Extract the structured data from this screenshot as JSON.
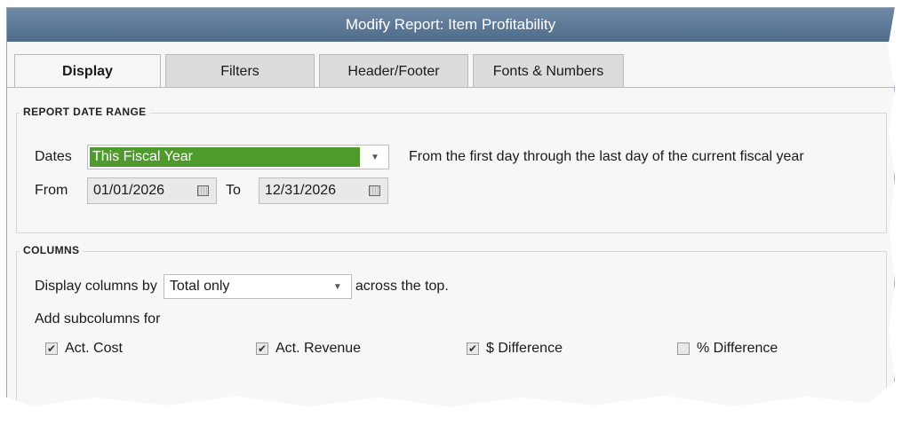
{
  "window": {
    "title": "Modify Report: Item Profitability"
  },
  "tabs": [
    {
      "label": "Display",
      "active": true
    },
    {
      "label": "Filters",
      "active": false
    },
    {
      "label": "Header/Footer",
      "active": false
    },
    {
      "label": "Fonts & Numbers",
      "active": false
    }
  ],
  "report_date_range": {
    "section_title": "REPORT DATE RANGE",
    "dates_label": "Dates",
    "dates_value": "This Fiscal Year",
    "description": "From the first day through the last day of the current fiscal year",
    "from_label": "From",
    "from_value": "01/01/2026",
    "to_label": "To",
    "to_value": "12/31/2026"
  },
  "columns": {
    "section_title": "COLUMNS",
    "display_by_label": "Display columns by",
    "display_by_value": "Total only",
    "across_label": "across the top.",
    "subcolumns_label": "Add subcolumns for",
    "subcolumns": [
      {
        "label": "Act. Cost",
        "checked": true
      },
      {
        "label": "Act. Revenue",
        "checked": true
      },
      {
        "label": "$ Difference",
        "checked": true
      },
      {
        "label": "% Difference",
        "checked": false
      }
    ]
  },
  "colors": {
    "titlebar": "#5a7694",
    "selected_green": "#4f9a2c",
    "dialog_bg": "#f7f7f7"
  }
}
